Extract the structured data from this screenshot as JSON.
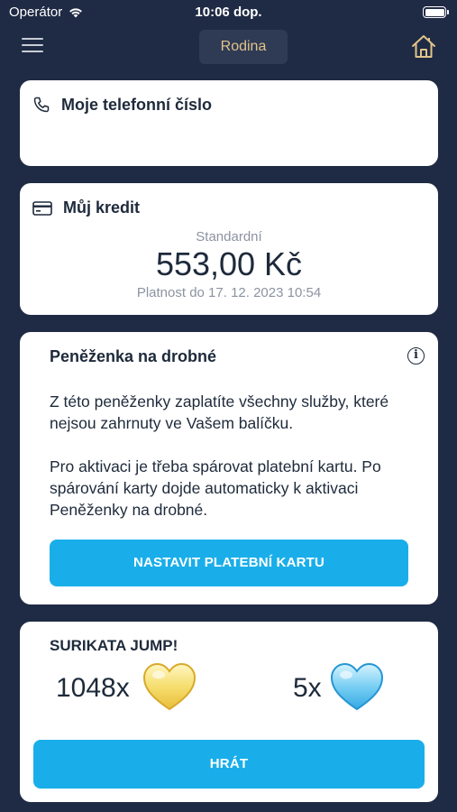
{
  "status_bar": {
    "carrier": "Operátor",
    "time": "10:06 dop.",
    "icons": [
      "wifi-icon",
      "battery-icon"
    ]
  },
  "header": {
    "menu_icon": "menu-icon",
    "family_tab": "Rodina",
    "home_icon": "home-icon",
    "accent": "#e0c48a"
  },
  "phone_card": {
    "icon": "phone-icon",
    "title": "Moje telefonní číslo"
  },
  "credit_card": {
    "icon": "credit-card-icon",
    "title": "Můj kredit",
    "type": "Standardní",
    "amount": "553,00 Kč",
    "valid_until": "Platnost do 17. 12. 2023 10:54"
  },
  "wallet_card": {
    "title": "Peněženka na drobné",
    "info_icon": "info-icon",
    "info_symbol": "i",
    "paragraph1": "Z této peněženky zaplatíte všechny služby, které nejsou zahrnuty ve Vašem balíčku.",
    "paragraph2": "Pro aktivaci je třeba spárovat platební kartu. Po spárování karty dojde automaticky k aktivaci Peněženky na drobné.",
    "button_label": "NASTAVIT PLATEBNÍ KARTU"
  },
  "game_card": {
    "title": "SURIKATA JUMP!",
    "gold_hearts": "1048x",
    "blue_hearts": "5x",
    "button_label": "HRÁT"
  },
  "colors": {
    "background": "#1f2a44",
    "card": "#ffffff",
    "button": "#19aeea",
    "text_primary": "#1e2a3b",
    "text_muted": "#8b93a1"
  }
}
